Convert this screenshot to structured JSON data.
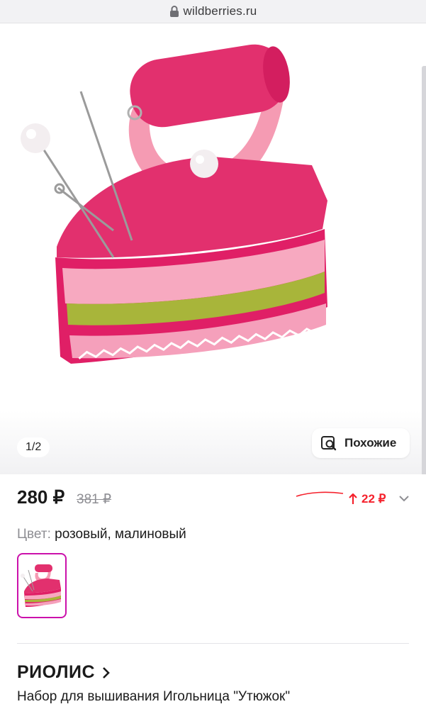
{
  "browser": {
    "domain": "wildberries.ru"
  },
  "gallery": {
    "counter": "1/2",
    "similar_label": "Похожие"
  },
  "price": {
    "current": "280 ₽",
    "old": "381 ₽",
    "change": "22 ₽",
    "change_color": "#f5222d"
  },
  "color": {
    "label": "Цвет:",
    "value": "розовый, малиновый",
    "accent": "#cb11ab"
  },
  "product": {
    "brand": "РИОЛИС",
    "title": "Набор для вышивания Игольница \"Утюжок\""
  },
  "icons": [
    "lock-icon",
    "similar-search-icon",
    "arrow-up-icon",
    "chevron-down-icon",
    "chevron-right-icon"
  ]
}
